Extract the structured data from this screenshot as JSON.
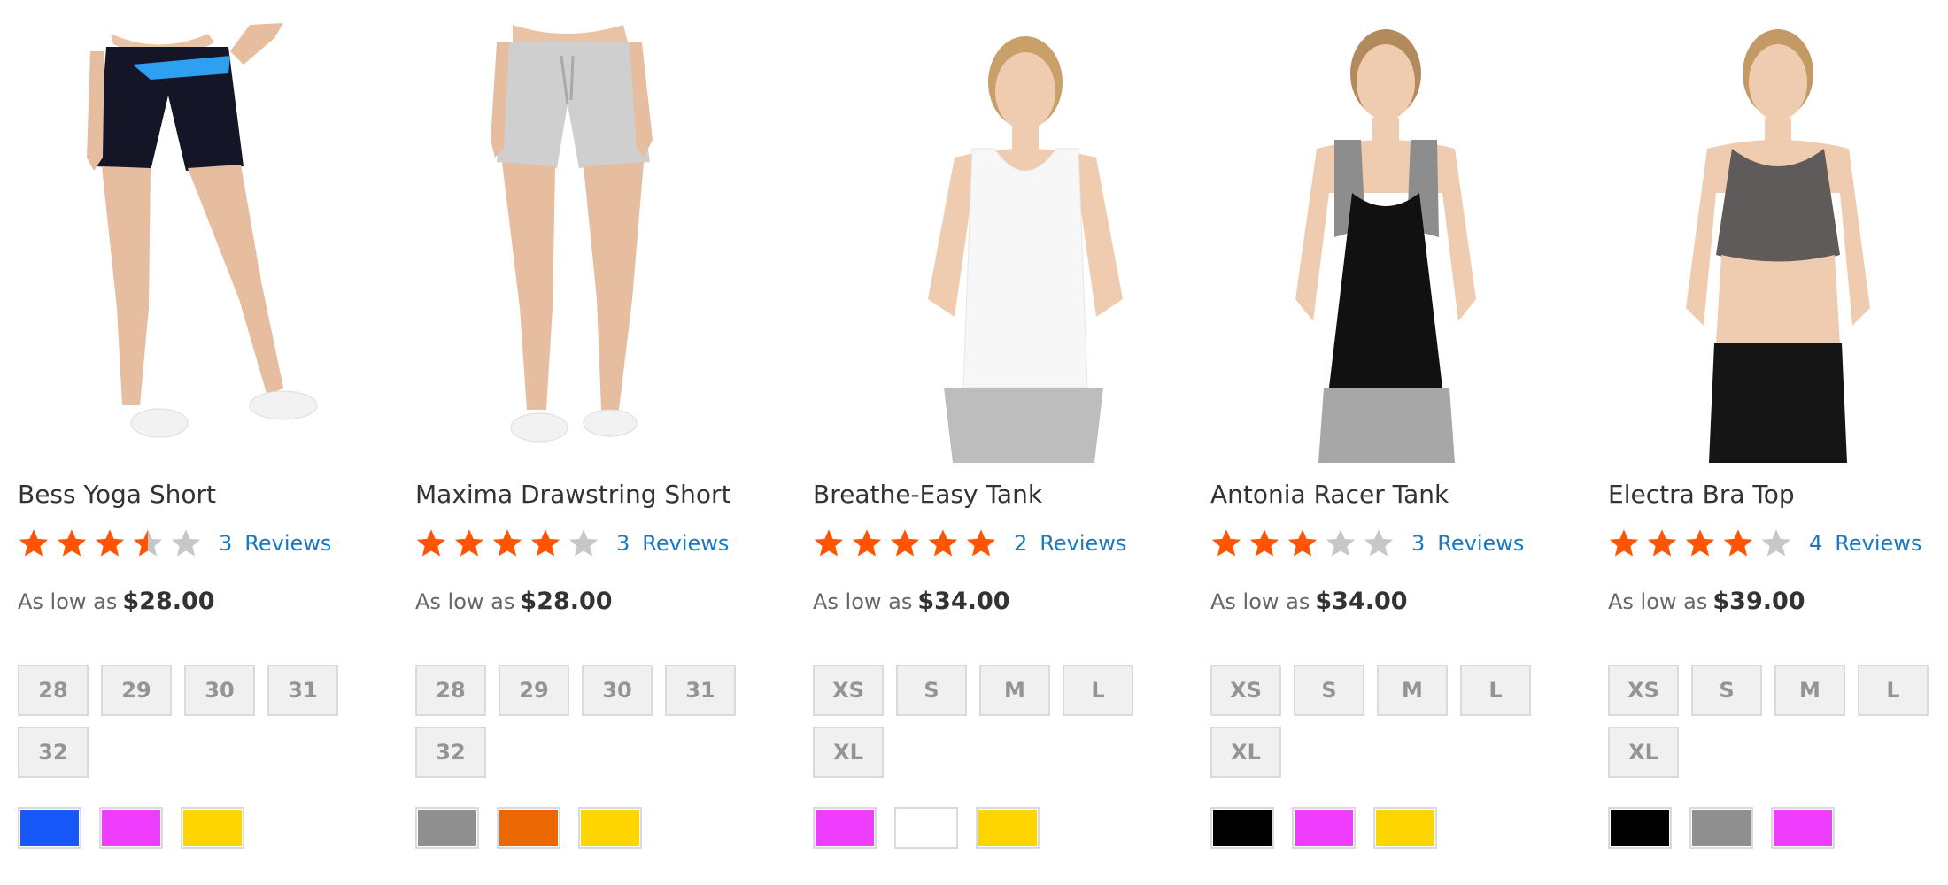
{
  "colors": {
    "star_on": "#ff5501",
    "star_off": "#c7c7c7",
    "link": "#1979c3"
  },
  "products": [
    {
      "name": "Bess Yoga Short",
      "rating": 3.5,
      "reviews_count": "3",
      "reviews_label": "Reviews",
      "price_label": "As low as",
      "price": "$28.00",
      "sizes": [
        "28",
        "29",
        "30",
        "31",
        "32"
      ],
      "swatches": [
        "#1857f7",
        "#ef3dff",
        "#ffd500"
      ]
    },
    {
      "name": "Maxima Drawstring Short",
      "rating": 4,
      "reviews_count": "3",
      "reviews_label": "Reviews",
      "price_label": "As low as",
      "price": "$28.00",
      "sizes": [
        "28",
        "29",
        "30",
        "31",
        "32"
      ],
      "swatches": [
        "#8f8f8f",
        "#eb6703",
        "#ffd500"
      ]
    },
    {
      "name": "Breathe-Easy Tank",
      "rating": 5,
      "reviews_count": "2",
      "reviews_label": "Reviews",
      "price_label": "As low as",
      "price": "$34.00",
      "sizes": [
        "XS",
        "S",
        "M",
        "L",
        "XL"
      ],
      "swatches": [
        "#ef3dff",
        "#ffffff",
        "#ffd500"
      ]
    },
    {
      "name": "Antonia Racer Tank",
      "rating": 3,
      "reviews_count": "3",
      "reviews_label": "Reviews",
      "price_label": "As low as",
      "price": "$34.00",
      "sizes": [
        "XS",
        "S",
        "M",
        "L",
        "XL"
      ],
      "swatches": [
        "#000000",
        "#ef3dff",
        "#ffd500"
      ]
    },
    {
      "name": "Electra Bra Top",
      "rating": 4,
      "reviews_count": "4",
      "reviews_label": "Reviews",
      "price_label": "As low as",
      "price": "$39.00",
      "sizes": [
        "XS",
        "S",
        "M",
        "L",
        "XL"
      ],
      "swatches": [
        "#000000",
        "#8f8f8f",
        "#ef3dff"
      ]
    }
  ]
}
